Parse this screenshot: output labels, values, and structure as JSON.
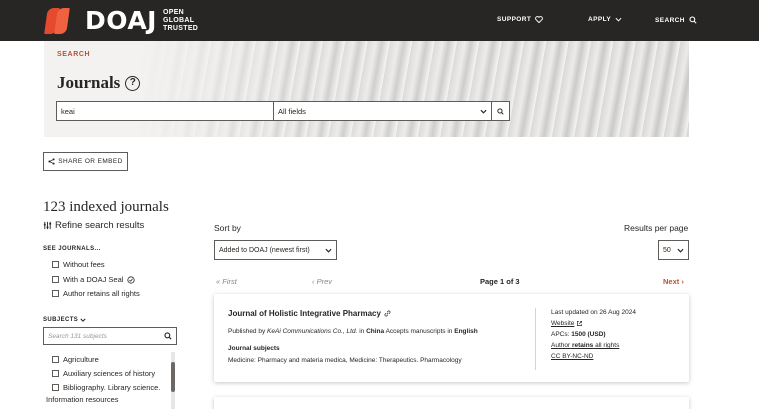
{
  "header": {
    "logo_text": "DOAJ",
    "tagline": [
      "OPEN",
      "GLOBAL",
      "TRUSTED"
    ],
    "nav": {
      "support": "SUPPORT",
      "apply": "APPLY",
      "search": "SEARCH"
    }
  },
  "hero": {
    "section_label": "SEARCH",
    "title": "Journals",
    "search_value": "keai",
    "field_select": "All fields"
  },
  "share_label": "SHARE OR EMBED",
  "results": {
    "count_title": "123 indexed journals",
    "refine_label": "Refine search results"
  },
  "filters": {
    "see_journals_head": "SEE JOURNALS...",
    "options": [
      "Without fees",
      "With a DOAJ Seal",
      "Author retains all rights"
    ],
    "subjects_head": "SUBJECTS",
    "subject_search_placeholder": "Search 131 subjects",
    "subjects": [
      "Agriculture",
      "Auxiliary sciences of history",
      "Bibliography. Library science."
    ],
    "subject_continuation": "Information resources"
  },
  "sort": {
    "label": "Sort by",
    "value": "Added to DOAJ (newest first)",
    "rpp_label": "Results per page",
    "rpp_value": "50"
  },
  "pagination": {
    "first": "First",
    "prev": "Prev",
    "current": "Page 1 of 3",
    "next": "Next"
  },
  "journal": {
    "title": "Journal of Holistic Integrative Pharmacy",
    "published_by": "Published by",
    "publisher": "KeAi Communications Co., Ltd.",
    "in": "in",
    "country": "China",
    "accepts": "Accepts manuscripts in",
    "language": "English",
    "subjects_head": "Journal subjects",
    "subjects": "Medicine: Pharmacy and materia medica, Medicine: Therapeutics. Pharmacology",
    "last_updated": "Last updated on 26 Aug 2024",
    "website": "Website",
    "apc_label": "APCs:",
    "apc_value": "1500 (USD)",
    "author_label": "Author",
    "retains": "retains",
    "all_rights": "all rights",
    "license": "CC BY-NC-ND"
  },
  "colors": {
    "header_bg": "#282624",
    "accent": "#b8552c",
    "logo": "#e64a2e"
  }
}
